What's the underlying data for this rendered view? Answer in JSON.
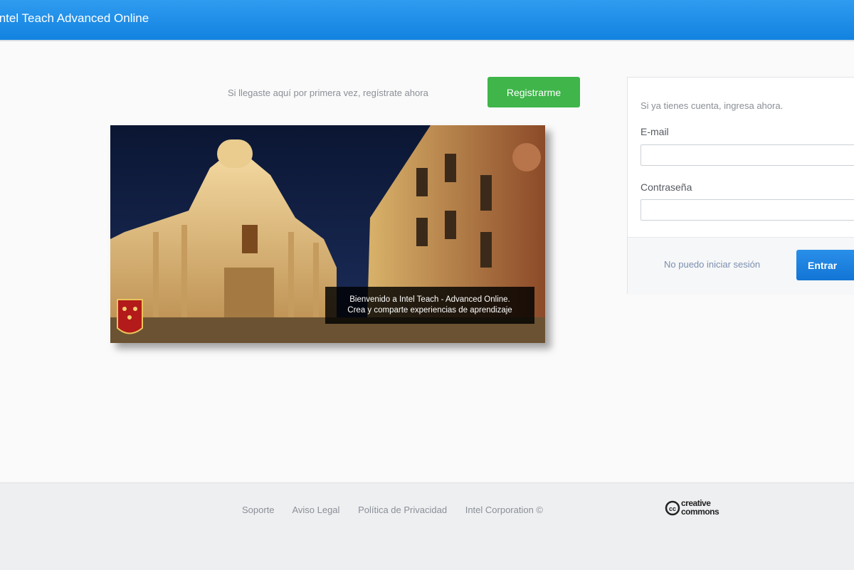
{
  "header": {
    "title": "Intel Teach Advanced Online",
    "color": "#1a8ae6"
  },
  "register": {
    "prompt": "Si llegaste aquí por primera vez, regístrate ahora",
    "button_label": "Registrarme",
    "color": "#3fb54a"
  },
  "hero": {
    "caption_line1": "Bienvenido a Intel Teach - Advanced Online.",
    "caption_line2": "Crea y comparte experiencias de aprendizaje"
  },
  "login": {
    "prompt": "Si ya tienes cuenta, ingresa ahora.",
    "email_label": "E-mail",
    "email_value": "",
    "password_label": "Contraseña",
    "password_value": "",
    "forgot_link": "No puedo iniciar sesión",
    "submit_label": "Entrar",
    "color": "#1a7fe0"
  },
  "footer": {
    "links": [
      {
        "label": "Soporte"
      },
      {
        "label": "Aviso Legal"
      },
      {
        "label": "Política de Privacidad"
      },
      {
        "label": "Intel Corporation ©"
      }
    ],
    "logo": "creative commons"
  }
}
